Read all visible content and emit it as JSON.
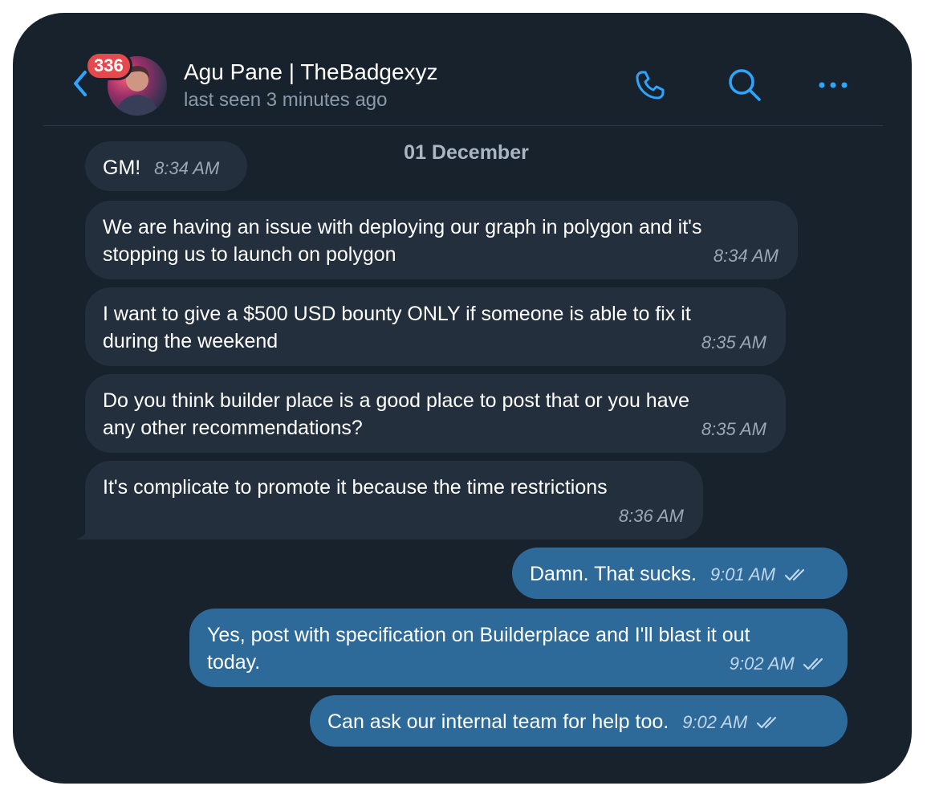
{
  "header": {
    "contact_name": "Agu Pane | TheBadgexyz",
    "status": "last seen 3 minutes ago",
    "unread_badge": "336",
    "icons": [
      "back-arrow",
      "avatar",
      "phone-icon",
      "search-icon",
      "more-icon"
    ],
    "accent_color": "#2ea6ff"
  },
  "chat": {
    "date_divider": "01 December",
    "messages": [
      {
        "direction": "incoming",
        "text": "GM!",
        "time": "8:34 AM"
      },
      {
        "direction": "incoming",
        "text": "We are having an issue with deploying our graph in polygon and it's\nstopping us to launch on polygon",
        "time": "8:34 AM"
      },
      {
        "direction": "incoming",
        "text": "I want to give a $500 USD bounty ONLY if someone is able to fix it\nduring the weekend",
        "time": "8:35 AM"
      },
      {
        "direction": "incoming",
        "text": "Do you think builder place is a good place to post that or you have\nany other recommendations?",
        "time": "8:35 AM"
      },
      {
        "direction": "incoming",
        "text": "It's complicate to promote it because the time restrictions",
        "time": "8:36 AM"
      },
      {
        "direction": "outgoing",
        "text": "Damn. That sucks.",
        "time": "9:01 AM"
      },
      {
        "direction": "outgoing",
        "text": "Yes, post with specification on Builderplace and I'll blast it out\ntoday.",
        "time": "9:02 AM"
      },
      {
        "direction": "outgoing",
        "text": "Can ask our internal team for help too.",
        "time": "9:02 AM"
      }
    ]
  },
  "colors": {
    "background": "#18222d",
    "incoming_bubble": "#232f3d",
    "outgoing_bubble": "#2d6a9a",
    "badge": "#e5484d"
  }
}
